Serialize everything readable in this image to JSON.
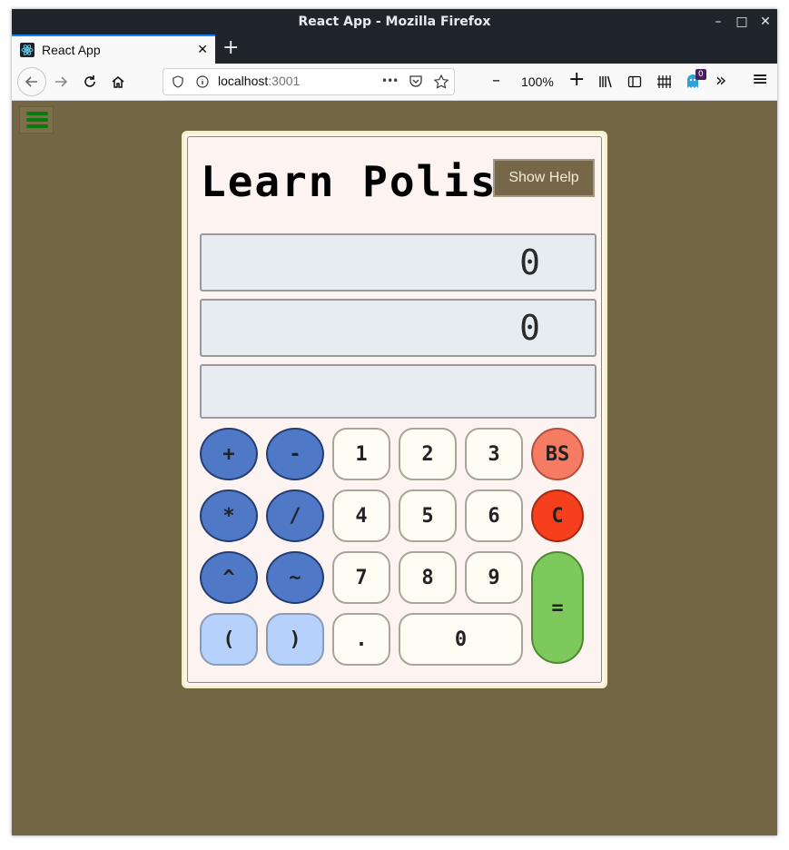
{
  "window": {
    "title": "React App - Mozilla Firefox",
    "controls": [
      "–",
      "□",
      "✕"
    ]
  },
  "tab": {
    "title": "React App",
    "close": "✕",
    "new_tab": "+"
  },
  "nav": {
    "url_host": "localhost",
    "url_port": ":3001",
    "page_actions": "•••",
    "zoom_minus": "–",
    "zoom": "100%",
    "zoom_plus": "+",
    "badge": "0",
    "overflow": "»",
    "menu": "≡"
  },
  "app": {
    "title": "Learn Polish",
    "help_button": "Show Help",
    "displays": [
      "0",
      "0",
      ""
    ],
    "keys": {
      "plus": "+",
      "minus": "-",
      "one": "1",
      "two": "2",
      "three": "3",
      "backspace": "BS",
      "multiply": "*",
      "divide": "/",
      "four": "4",
      "five": "5",
      "six": "6",
      "clear": "C",
      "power": "^",
      "negate": "~",
      "seven": "7",
      "eight": "8",
      "nine": "9",
      "lparen": "(",
      "rparen": ")",
      "dot": ".",
      "zero": "0",
      "equals": "="
    }
  },
  "colors": {
    "background": "#736645",
    "operator": "#4f79c7",
    "paren": "#b6d1fb",
    "backspace": "#f57b62",
    "clear": "#f6401d",
    "equals": "#7ec95b"
  }
}
